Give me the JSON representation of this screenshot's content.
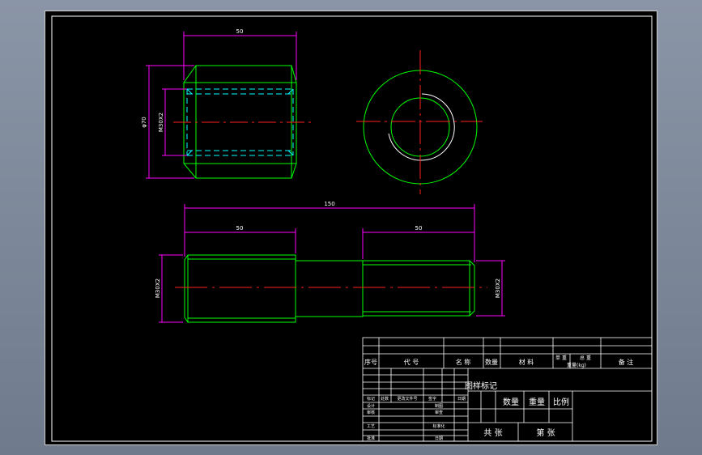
{
  "colors": {
    "background": "#000000",
    "outline": "#00ff00",
    "hidden": "#00ffff",
    "center": "#ff2020",
    "dimension": "#ff00ff",
    "table": "#ffffff"
  },
  "dimensions": {
    "top_width": "50",
    "top_outer_dia": "φ70",
    "top_thread": "M30X2",
    "overall_length": "150",
    "left_length": "50",
    "right_length": "50",
    "left_thread": "M30X2",
    "right_thread": "M30X2"
  },
  "title_block": {
    "header": {
      "seq": "序号",
      "code": "代  号",
      "name": "名  称",
      "qty": "数量",
      "material": "材  料",
      "unit_weight": "单  重",
      "total_weight": "总  重",
      "weight_unit": "重量(kg)",
      "remark": "备  注"
    },
    "revision": {
      "mark": "标记",
      "zones": "处数",
      "doc": "更改文件号",
      "sign": "签字",
      "date": "日期"
    },
    "approval": {
      "design": "设计",
      "check": "审核",
      "process": "工艺",
      "std": "标准化",
      "approve": "批准",
      "date": "日期",
      "draw": "制图",
      "review": "审查"
    },
    "stage_label": "图样标记",
    "qty_label": "数量",
    "weight_label": "重量",
    "scale_label": "比例",
    "total_sheets": "共  张",
    "sheet_no": "第  张"
  }
}
